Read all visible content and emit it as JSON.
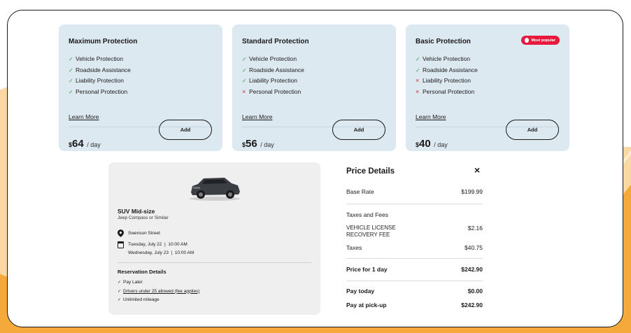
{
  "protection_cards": [
    {
      "title": "Maximum Protection",
      "features": [
        {
          "label": "Vehicle Protection",
          "included": true
        },
        {
          "label": "Roadside Assistance",
          "included": true
        },
        {
          "label": "Liability Protection",
          "included": true
        },
        {
          "label": "Personal Protection",
          "included": true
        }
      ],
      "learn_more": "Learn More",
      "currency": "$",
      "price": "64",
      "per": "/ day",
      "add_label": "Add",
      "badge": null
    },
    {
      "title": "Standard Protection",
      "features": [
        {
          "label": "Vehicle Protection",
          "included": true
        },
        {
          "label": "Roadside Assistance",
          "included": true
        },
        {
          "label": "Liability Protection",
          "included": true
        },
        {
          "label": "Personal Protection",
          "included": false
        }
      ],
      "learn_more": "Learn More",
      "currency": "$",
      "price": "56",
      "per": "/ day",
      "add_label": "Add",
      "badge": null
    },
    {
      "title": "Basic Protection",
      "features": [
        {
          "label": "Vehicle Protection",
          "included": true
        },
        {
          "label": "Roadside Assistance",
          "included": true
        },
        {
          "label": "Liability Protection",
          "included": false
        },
        {
          "label": "Personal Protection",
          "included": false
        }
      ],
      "learn_more": "Learn More",
      "currency": "$",
      "price": "40",
      "per": "/ day",
      "add_label": "Add",
      "badge": "Most popular"
    }
  ],
  "vehicle": {
    "name": "SUV Mid-size",
    "model": "Jeep Compass or Similar",
    "location": "Swenson Street",
    "pickup": "Tuesday, July 22  |  10:00 AM",
    "dropoff": "Wednesday, July 23  |  10:00 AM",
    "reservation_title": "Reservation Details",
    "reservation_items": [
      {
        "label": "Pay Later",
        "link": false
      },
      {
        "label": "Drivers under 25 allowed (fee applies)",
        "link": true
      },
      {
        "label": "Unlimited mileage",
        "link": false
      }
    ]
  },
  "price_details": {
    "title": "Price Details",
    "close_icon": "×",
    "base_rate_label": "Base Rate",
    "base_rate": "$199.99",
    "taxes_fees_label": "Taxes and Fees",
    "vlrf_label": "VEHICLE LICENSE RECOVERY FEE",
    "vlrf": "$2.16",
    "taxes_label": "Taxes",
    "taxes": "$40.75",
    "price_label": "Price for 1 day",
    "price": "$242.90",
    "pay_today_label": "Pay today",
    "pay_today": "$0.00",
    "pay_pickup_label": "Pay at pick-up",
    "pay_pickup": "$242.90"
  },
  "colors": {
    "card_bg": "#dde9f1",
    "included": "#3aa24a",
    "excluded": "#d9262b",
    "badge": "#e8193c",
    "background_accent": "#f4a93a"
  }
}
